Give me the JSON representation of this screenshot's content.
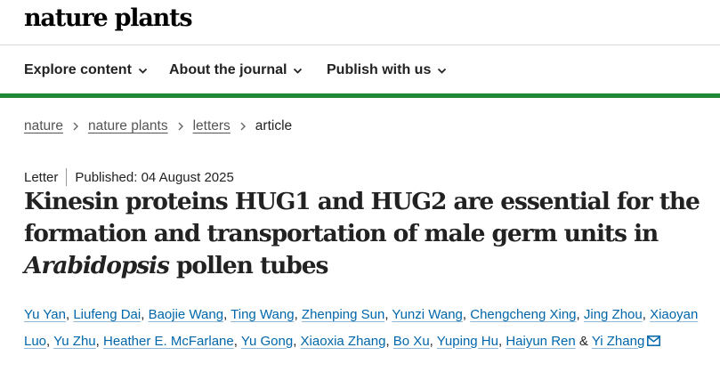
{
  "brand": {
    "name": "nature plants"
  },
  "nav": {
    "items": [
      {
        "label": "Explore content"
      },
      {
        "label": "About the journal"
      },
      {
        "label": "Publish with us"
      }
    ]
  },
  "breadcrumb": {
    "items": [
      "nature",
      "nature plants",
      "letters"
    ],
    "current": "article"
  },
  "article": {
    "type": "Letter",
    "published": "Published: 04 August 2025",
    "title_part1": "Kinesin proteins HUG1 and HUG2 are essential for the formation and transportation of male germ units in ",
    "title_italic": "Arabidopsis",
    "title_part2": " pollen tubes",
    "authors": [
      "Yu Yan",
      "Liufeng Dai",
      "Baojie Wang",
      "Ting Wang",
      "Zhenping Sun",
      "Yunzi Wang",
      "Chengcheng Xing",
      "Jing Zhou",
      "Xiaoyan Luo",
      "Yu Zhu",
      "Heather E. McFarlane",
      "Yu Gong",
      "Xiaoxia Zhang",
      "Bo Xu",
      "Yuping Hu",
      "Haiyun Ren",
      "Yi Zhang"
    ],
    "author_connector": "&",
    "author_separator": ","
  },
  "colors": {
    "accent": "#1e8836",
    "link": "#0066aa"
  },
  "icons": {
    "nav_chevron": "chevron-down-icon",
    "breadcrumb_sep": "chevron-right-icon",
    "corresponding": "mail-icon"
  }
}
